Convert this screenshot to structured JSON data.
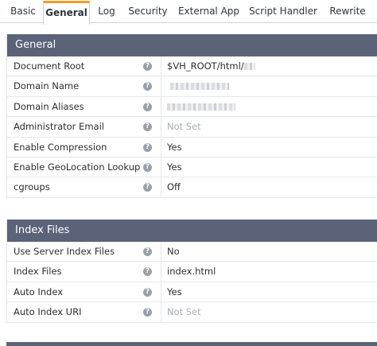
{
  "tabs": [
    {
      "label": "Basic",
      "active": false
    },
    {
      "label": "General",
      "active": true
    },
    {
      "label": "Log",
      "active": false
    },
    {
      "label": "Security",
      "active": false
    },
    {
      "label": "External App",
      "active": false
    },
    {
      "label": "Script Handler",
      "active": false
    },
    {
      "label": "Rewrite",
      "active": false
    }
  ],
  "general": {
    "title": "General",
    "rows": [
      {
        "label": "Document Root",
        "value": "$VH_ROOT/html/",
        "muted": false,
        "redacted": true
      },
      {
        "label": "Domain Name",
        "value": "",
        "muted": false,
        "redacted": true
      },
      {
        "label": "Domain Aliases",
        "value": "",
        "muted": false,
        "redacted": true
      },
      {
        "label": "Administrator Email",
        "value": "Not Set",
        "muted": true,
        "redacted": false
      },
      {
        "label": "Enable Compression",
        "value": "Yes",
        "muted": false,
        "redacted": false
      },
      {
        "label": "Enable GeoLocation Lookup",
        "value": "Yes",
        "muted": false,
        "redacted": false
      },
      {
        "label": "cgroups",
        "value": "Off",
        "muted": false,
        "redacted": false
      }
    ]
  },
  "index_files": {
    "title": "Index Files",
    "rows": [
      {
        "label": "Use Server Index Files",
        "value": "No",
        "muted": false,
        "redacted": false
      },
      {
        "label": "Index Files",
        "value": "index.html",
        "muted": false,
        "redacted": false
      },
      {
        "label": "Auto Index",
        "value": "Yes",
        "muted": false,
        "redacted": false
      },
      {
        "label": "Auto Index URI",
        "value": "Not Set",
        "muted": true,
        "redacted": false
      }
    ]
  },
  "help_icon_glyph": "?",
  "colors": {
    "header_bg": "#5b6379",
    "active_tab_accent": "#f29b25",
    "muted_text": "#a8adb3"
  }
}
